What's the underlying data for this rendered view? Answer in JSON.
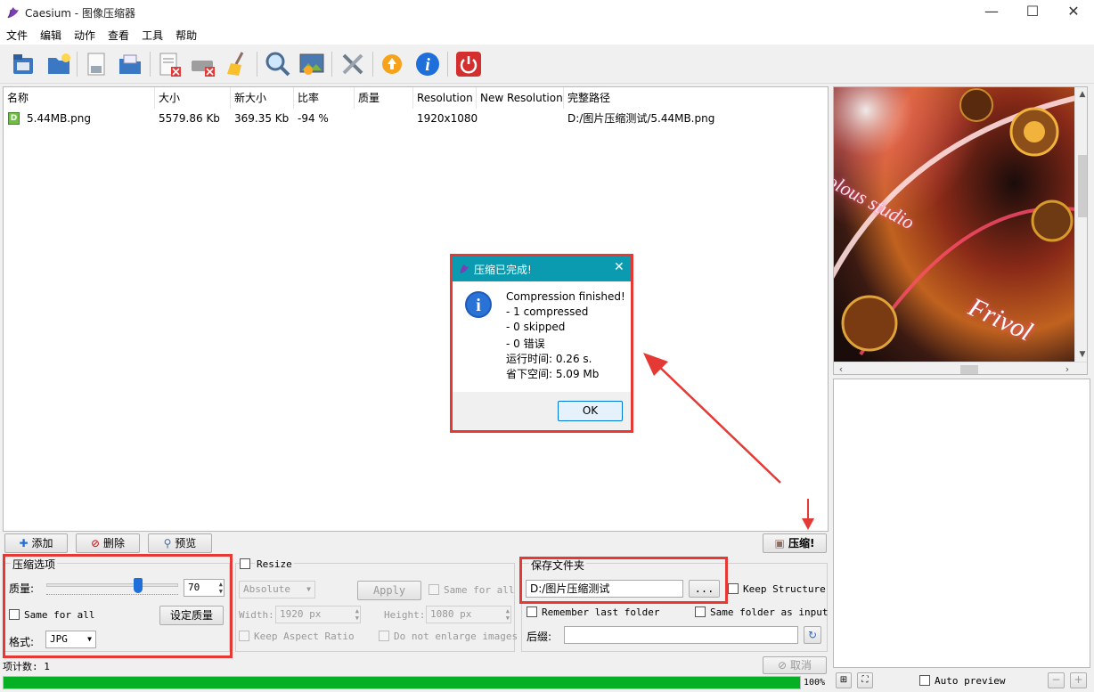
{
  "window": {
    "title": "Caesium - 图像压缩器"
  },
  "menu": [
    "文件",
    "编辑",
    "动作",
    "查看",
    "工具",
    "帮助"
  ],
  "toolbar": {
    "icons": [
      "open-file-icon",
      "open-folder-icon",
      "save-icon",
      "save-all-icon",
      "remove-item-icon",
      "clear-list-icon",
      "broom-icon",
      "zoom-icon",
      "preview-image-icon",
      "settings-tools-icon",
      "update-icon",
      "info-icon",
      "power-icon"
    ]
  },
  "file_list": {
    "columns": [
      "名称",
      "大小",
      "新大小",
      "比率",
      "质量",
      "Resolution",
      "New Resolution",
      "完整路径"
    ],
    "rows": [
      {
        "name": "5.44MB.png",
        "size": "5579.86 Kb",
        "new_size": "369.35 Kb",
        "ratio": "-94 %",
        "quality": "",
        "resolution": "1920x1080",
        "new_resolution": "",
        "path": "D:/图片压缩测试/5.44MB.png"
      }
    ],
    "row_badge": "D"
  },
  "actions": {
    "add": "添加",
    "remove": "删除",
    "preview": "预览",
    "compress": "压缩!"
  },
  "compression": {
    "group_title": "压缩选项",
    "quality_label": "质量:",
    "quality_value": "70",
    "quality_level": 0.7,
    "same_for_all": "Same for all",
    "set_quality": "设定质量",
    "format_label": "格式:",
    "format_value": "JPG"
  },
  "resize": {
    "title": "Resize",
    "mode": "Absolute",
    "apply": "Apply",
    "same_for_all": "Same for all",
    "width_label": "Width:",
    "width_value": "1920 px",
    "height_label": "Height:",
    "height_value": "1080 px",
    "keep_aspect": "Keep Aspect Ratio",
    "no_enlarge": "Do not enlarge images"
  },
  "output": {
    "group_title": "保存文件夹",
    "folder": "D:/图片压缩测试",
    "browse": "...",
    "keep_structure": "Keep Structure",
    "remember_last": "Remember last folder",
    "same_folder": "Same folder as input",
    "suffix_label": "后缀:",
    "suffix_value": ""
  },
  "preview": {
    "watermark_text": "olous studio",
    "watermark_sign": "Frivol"
  },
  "dialog": {
    "title": "压缩已完成!",
    "lines": [
      "Compression finished!",
      "- 1 compressed",
      "- 0 skipped",
      "- 0 错误",
      "运行时间: 0.26 s.",
      "省下空间: 5.09 Mb"
    ],
    "ok": "OK"
  },
  "status": {
    "item_count": "项计数: 1",
    "cancel": "取消",
    "progress_percent": 100,
    "progress_text": "100%",
    "auto_preview": "Auto preview"
  },
  "colors": {
    "accent_red": "#e53935",
    "dialog_title": "#0a9bb0",
    "progress": "#06b025"
  }
}
